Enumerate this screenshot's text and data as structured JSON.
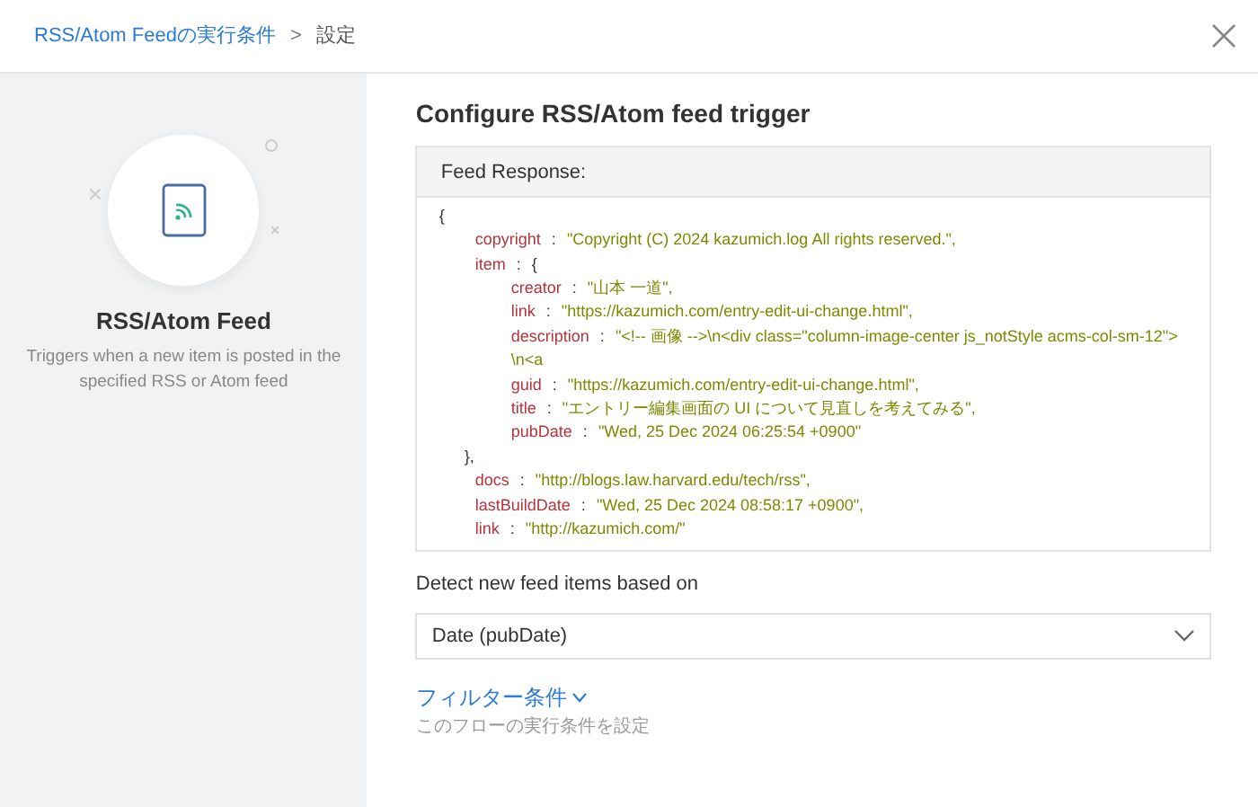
{
  "breadcrumb": {
    "link": "RSS/Atom Feedの実行条件",
    "separator": ">",
    "current": "設定"
  },
  "trigger": {
    "title": "RSS/Atom Feed",
    "description": "Triggers when a new item is posted in the specified RSS or Atom feed"
  },
  "heading": "Configure RSS/Atom feed trigger",
  "feed_response": {
    "title": "Feed Response:",
    "open": "{",
    "entries": [
      {
        "key": "copyright",
        "sep": ":",
        "value": "\"Copyright (C) 2024 kazumich.log All rights reserved.\","
      },
      {
        "key": "item",
        "sep": ":",
        "value": "{",
        "close": "},",
        "children": [
          {
            "key": "creator",
            "sep": ":",
            "value": "\"山本 一道\","
          },
          {
            "key": "link",
            "sep": ":",
            "value": "\"https://kazumich.com/entry-edit-ui-change.html\","
          },
          {
            "key": "description",
            "sep": ":",
            "value": "\"<!-- 画像 -->\\n<div class=\"column-image-center js_notStyle acms-col-sm-12\">\\n<a"
          },
          {
            "key": "guid",
            "sep": ":",
            "value": "\"https://kazumich.com/entry-edit-ui-change.html\","
          },
          {
            "key": "title",
            "sep": ":",
            "value": "\"エントリー編集画面の UI について見直しを考えてみる\","
          },
          {
            "key": "pubDate",
            "sep": ":",
            "value": "\"Wed, 25 Dec 2024 06:25:54 +0900\""
          }
        ]
      },
      {
        "key": "docs",
        "sep": ":",
        "value": "\"http://blogs.law.harvard.edu/tech/rss\","
      },
      {
        "key": "lastBuildDate",
        "sep": ":",
        "value": "\"Wed, 25 Dec 2024 08:58:17 +0900\","
      },
      {
        "key": "link",
        "sep": ":",
        "value": "\"http://kazumich.com/\""
      }
    ]
  },
  "detect": {
    "label": "Detect new feed items based on",
    "value": "Date (pubDate)"
  },
  "filter": {
    "link": "フィルター条件",
    "description": "このフローの実行条件を設定"
  }
}
